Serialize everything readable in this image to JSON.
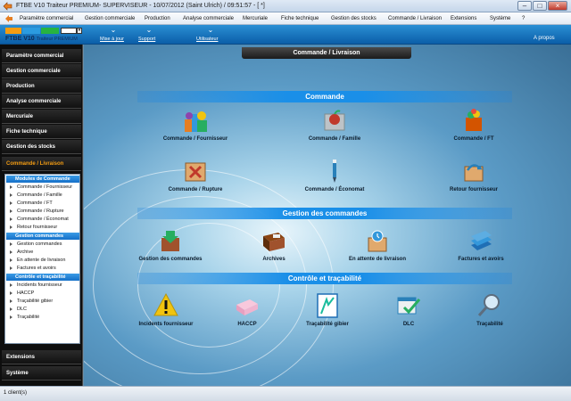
{
  "window": {
    "title": "FTBE V10 Traiteur PREMIUM- SUPERVISEUR - 10/07/2012 (Saint Ulrich) / 09:51:57 - [ *]",
    "minimize": "–",
    "maximize": "□",
    "close": "×"
  },
  "menu": [
    "Paramètre commercial",
    "Gestion commerciale",
    "Production",
    "Analyse commerciale",
    "Mercuriale",
    "Fiche technique",
    "Gestion des stocks",
    "Commande / Livraison",
    "Extensions",
    "Système",
    "?"
  ],
  "toolbar": {
    "brand": "FTBE V10",
    "brand_sub": "Traiteur PREMIUM",
    "buttons": [
      "Mise à jour",
      "Support",
      "Utilisateur"
    ],
    "about": "A propos",
    "color_strip": [
      "#f39c12",
      "#2b9be0",
      "#27b341"
    ]
  },
  "sidebar": {
    "items": [
      "Paramètre commercial",
      "Gestion commerciale",
      "Production",
      "Analyse commerciale",
      "Mercuriale",
      "Fiche technique",
      "Gestion des stocks",
      "Commande / Livraison"
    ],
    "active": "Commande / Livraison",
    "sub": {
      "h1": "Modules de Commande",
      "g1": [
        "Commande / Fournisseur",
        "Commande / Famille",
        "Commande / FT",
        "Commande / Rupture",
        "Commande / Économat",
        "Retour fournisseur"
      ],
      "h2": "Gestion commandes",
      "g2": [
        "Gestion commandes",
        "Archive",
        "En attente de livraison",
        "Factures et avoirs"
      ],
      "h3": "Contrôle et traçabilité",
      "g3": [
        "Incidents fournisseur",
        "HACCP",
        "Traçabilité gibier",
        "DLC",
        "Traçabilité"
      ]
    },
    "bottom": [
      "Extensions",
      "Système"
    ]
  },
  "main": {
    "tab": "Commande / Livraison",
    "sections": [
      "Commande",
      "Gestion des commandes",
      "Contrôle et traçabilité"
    ],
    "commande": [
      "Commande / Fournisseur",
      "Commande / Famille",
      "Commande / FT",
      "Commande / Rupture",
      "Commande / Économat",
      "Retour fournisseur"
    ],
    "gestion": [
      "Gestion des commandes",
      "Archives",
      "En attente de livraison",
      "Factures et avoirs"
    ],
    "controle": [
      "Incidents fournisseur",
      "HACCP",
      "Traçabilité gibier",
      "DLC",
      "Traçabilité"
    ]
  },
  "status": "1 client(s)"
}
